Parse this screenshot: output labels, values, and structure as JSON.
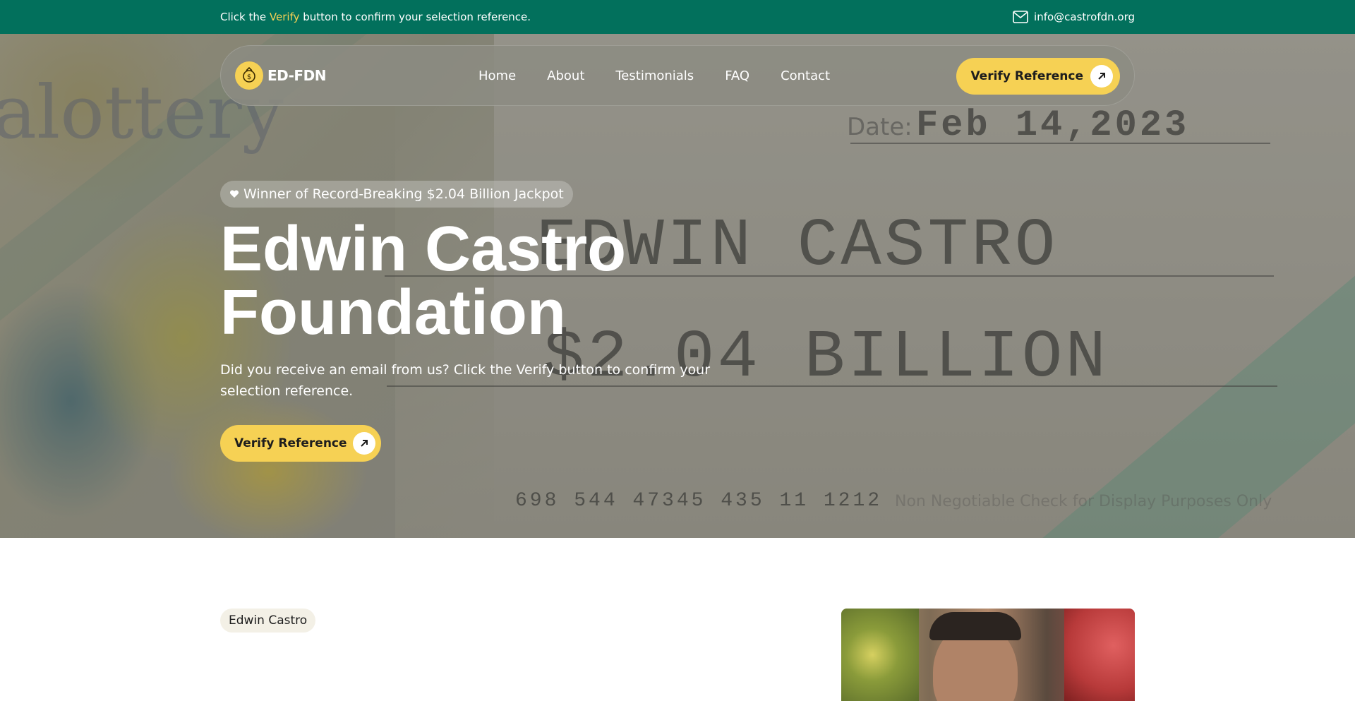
{
  "topbar": {
    "message_before": "Click the ",
    "message_highlight": "Verify",
    "message_after": " button to confirm your selection reference.",
    "email": "info@castrofdn.org"
  },
  "nav": {
    "logo_text": "ED-FDN",
    "links": [
      "Home",
      "About",
      "Testimonials",
      "FAQ",
      "Contact"
    ],
    "cta_label": "Verify Reference"
  },
  "hero": {
    "badge_text": "Winner of Record-Breaking $2.04 Billion Jackpot",
    "title_line1": "Edwin Castro",
    "title_line2": "Foundation",
    "subtitle": "Did you receive an email from us? Click the Verify button to confirm your selection reference.",
    "cta_label": "Verify Reference"
  },
  "about": {
    "tag": "Edwin Castro"
  },
  "colors": {
    "brand_green": "#02705c",
    "accent_yellow": "#f6d154",
    "text_white": "#ffffff"
  }
}
